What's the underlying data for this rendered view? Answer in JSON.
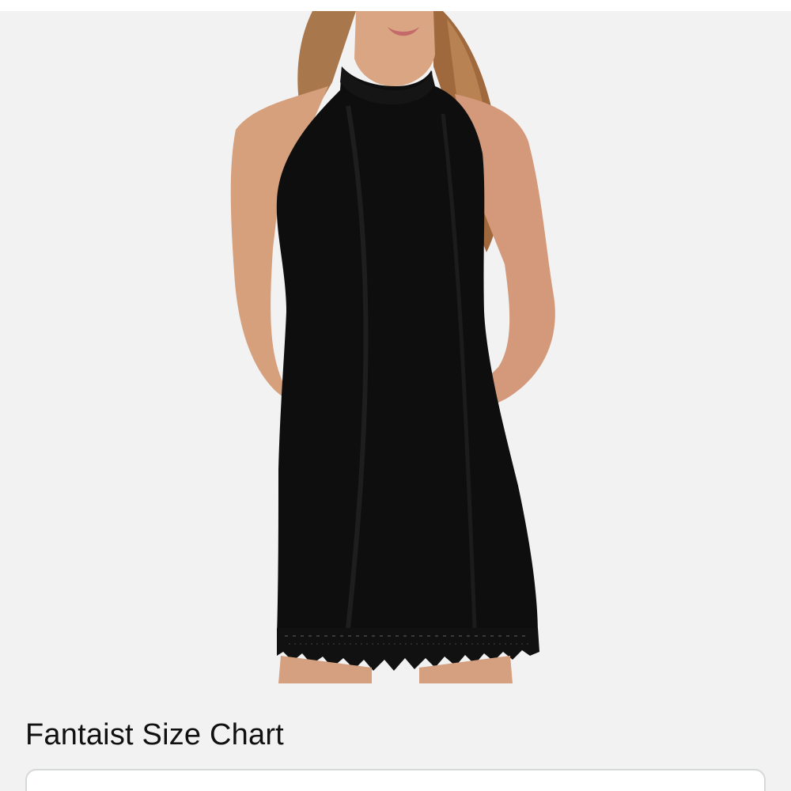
{
  "product_image": {
    "icon": "product-photo-black-halter-lace-hem-dress"
  },
  "size_chart": {
    "title": "Fantaist Size Chart"
  }
}
